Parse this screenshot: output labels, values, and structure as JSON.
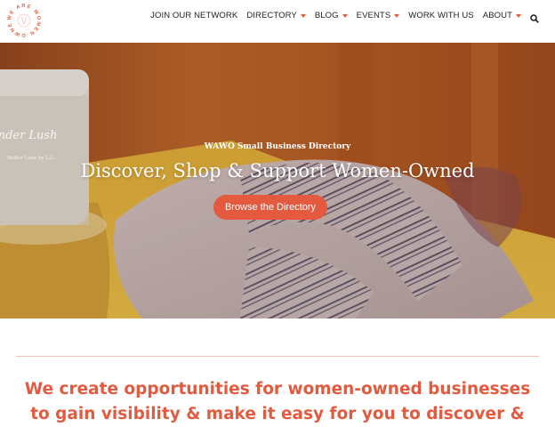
{
  "logo": {
    "text": "WE ARE WOMEN OWNED",
    "color": "#e45a3f"
  },
  "nav": {
    "items": [
      {
        "label": "JOIN OUR NETWORK",
        "dropdown": false
      },
      {
        "label": "DIRECTORY",
        "dropdown": true
      },
      {
        "label": "BLOG",
        "dropdown": true
      },
      {
        "label": "EVENTS",
        "dropdown": true
      },
      {
        "label": "WORK WITH US",
        "dropdown": false
      },
      {
        "label": "ABOUT",
        "dropdown": true
      }
    ],
    "search_icon": "search-icon"
  },
  "hero": {
    "subtitle": "WAWO Small Business Directory",
    "title": "Discover, Shop & Support Women-Owned",
    "button_label": "Browse the Directory",
    "jar_label_line1": "ender Lush",
    "jar_label_line2": "Butter Luxe by L.L."
  },
  "tagline": {
    "line1": "We create opportunities for women-owned businesses",
    "line2": "to gain visibility & make it easy for you to discover &"
  },
  "colors": {
    "accent": "#e45a3f",
    "text": "#222222"
  }
}
